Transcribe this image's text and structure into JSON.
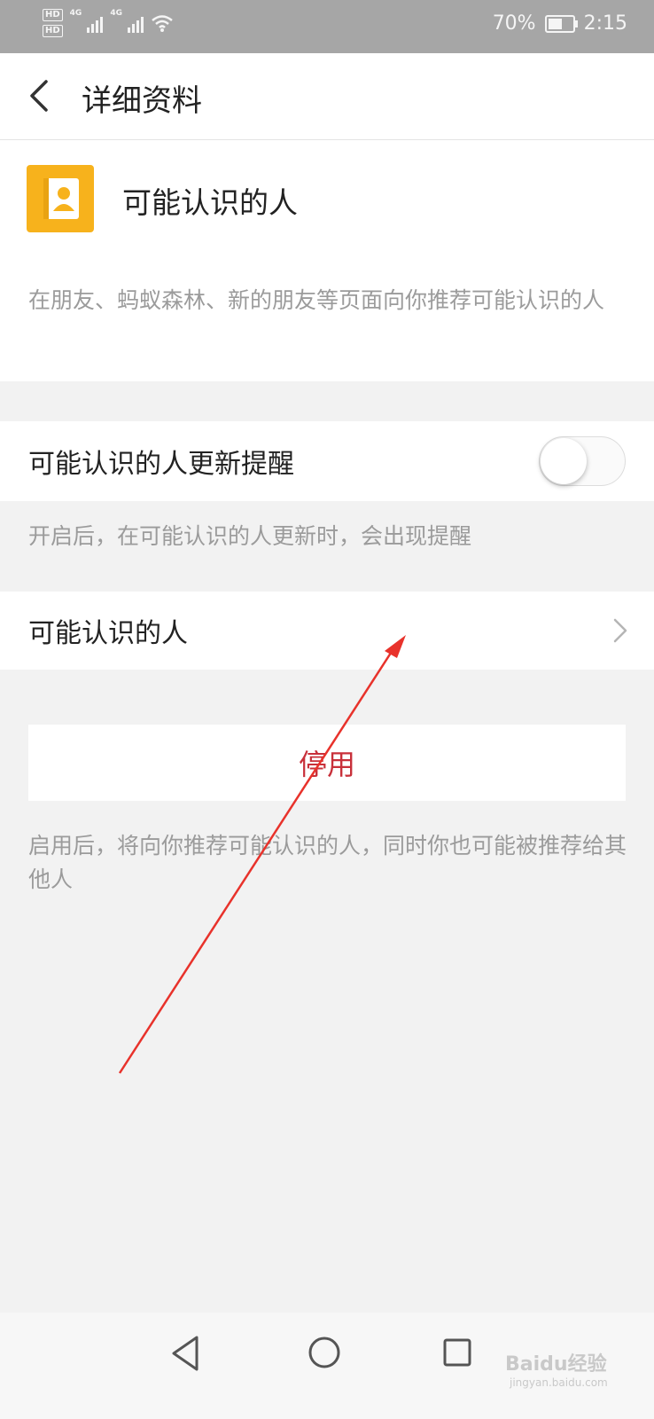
{
  "status_bar": {
    "hd1": "HD",
    "hd2": "HD",
    "net1": "4G",
    "net2": "4G",
    "battery_percent": "70%",
    "battery_level": 0.7,
    "time": "2:15",
    "icons": [
      "signal-icon",
      "wifi-icon",
      "battery-icon"
    ]
  },
  "header": {
    "title": "详细资料",
    "back_icon": "chevron-left-icon"
  },
  "profile_card": {
    "icon": "contacts-book-icon",
    "icon_color": "#f7b21c",
    "title": "可能认识的人",
    "description": "在朋友、蚂蚁森林、新的朋友等页面向你推荐可能认识的人"
  },
  "update_reminder": {
    "label": "可能认识的人更新提醒",
    "enabled": false,
    "hint": "开启后，在可能认识的人更新时，会出现提醒"
  },
  "people_row": {
    "label": "可能认识的人",
    "icon": "chevron-right-icon"
  },
  "disable_button": {
    "label": "停用",
    "color": "#c8303a"
  },
  "bottom_hint": "启用后，将向你推荐可能认识的人，同时你也可能被推荐给其他人",
  "annotation": {
    "color": "#e8322b"
  },
  "nav_bar": {
    "icons": [
      "triangle-back-icon",
      "circle-home-icon",
      "square-recent-icon"
    ]
  },
  "watermark": {
    "text": "Baidu经验",
    "sub": "jingyan.baidu.com"
  }
}
